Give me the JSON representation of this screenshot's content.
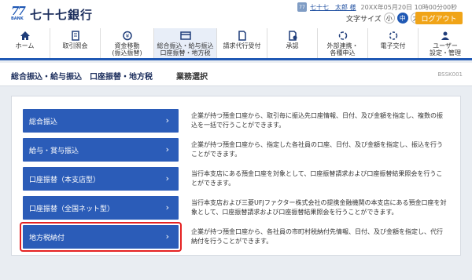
{
  "brand": {
    "logo_number": "77",
    "logo_sub": "BANK",
    "bank_name": "七十七銀行"
  },
  "user": {
    "icon_text": "77",
    "name": "七十七　太郎 様",
    "last_login": "20XX年05月20日 10時00分00秒"
  },
  "font_size": {
    "label": "文字サイズ",
    "options": [
      "小",
      "中",
      "大"
    ],
    "selected": "中"
  },
  "logout_label": "ログアウト",
  "nav": [
    {
      "label": "ホーム",
      "icon": "home-icon"
    },
    {
      "label": "取引照会",
      "icon": "document-list-icon"
    },
    {
      "label": "資金移動\n(振込振替)",
      "icon": "money-transfer-icon"
    },
    {
      "label": "総合振込・給与振込\n口座振替・地方税",
      "icon": "card-icon",
      "active": true
    },
    {
      "label": "請求代行受付",
      "icon": "file-icon"
    },
    {
      "label": "承認",
      "icon": "approve-icon"
    },
    {
      "label": "外部連携・\n各種申込",
      "icon": "link-icon"
    },
    {
      "label": "電子交付",
      "icon": "mail-icon"
    },
    {
      "label": "ユーザー\n設定・管理",
      "icon": "user-settings-icon"
    }
  ],
  "breadcrumb": {
    "main": "総合振込・給与振込　口座振替・地方税",
    "sub": "業務選択",
    "screen_id": "BSSK001"
  },
  "menu": [
    {
      "label": "総合振込",
      "desc": "企業が持つ預金口座から、取引毎に振込先口座情報、日付、及び金額を指定し、複数の振込を一括で行うことができます。"
    },
    {
      "label": "給与・賞与振込",
      "desc": "企業が持つ預金口座から、指定した各社員の口座、日付、及び金額を指定し、振込を行うことができます。"
    },
    {
      "label": "口座振替（本支店型）",
      "desc": "当行本支店にある預金口座を対象として、口座振替請求および口座振替結果照会を行うことができます。"
    },
    {
      "label": "口座振替（全国ネット型）",
      "desc": "当行本支店および三菱UFJファクター株式会社の提携金融機関の本支店にある預金口座を対象として、口座振替請求および口座振替結果照会を行うことができます。"
    },
    {
      "label": "地方税納付",
      "desc": "企業が持つ預金口座から、各社員の市町村税納付先情報、日付、及び金額を指定し、代行納付を行うことができます。",
      "highlighted": true
    }
  ],
  "colors": {
    "accent": "#1f58b4",
    "button": "#2b5cb8",
    "logout": "#f0a418",
    "highlight": "#e52222"
  }
}
